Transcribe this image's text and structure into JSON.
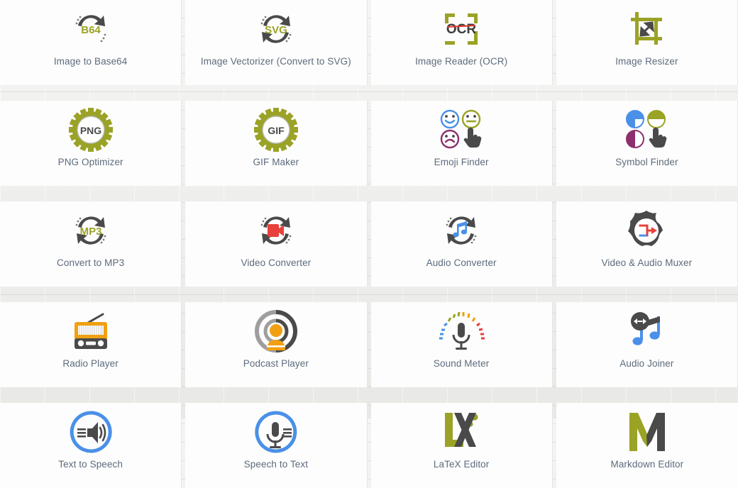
{
  "colors": {
    "olive": "#9aa326",
    "dark_gray": "#4a4a4a",
    "blue": "#4a90e8",
    "purple": "#8e2f6e",
    "red": "#e8403a",
    "orange": "#f0a011",
    "label": "#5d6b7c",
    "card_bg": "#fdfdfd",
    "page_bg": "#e9e9e7"
  },
  "grid": {
    "columns": 4,
    "rows": 5,
    "tools": [
      {
        "id": "image-to-base64",
        "label": "Image to Base64",
        "icon": "refresh-arrows-b64-icon"
      },
      {
        "id": "image-vectorizer",
        "label": "Image Vectorizer (Convert to SVG)",
        "icon": "refresh-arrows-svg-icon"
      },
      {
        "id": "image-reader-ocr",
        "label": "Image Reader (OCR)",
        "icon": "ocr-scan-frame-icon"
      },
      {
        "id": "image-resizer",
        "label": "Image Resizer",
        "icon": "crop-resize-arrow-icon"
      },
      {
        "id": "png-optimizer",
        "label": "PNG Optimizer",
        "icon": "gear-png-icon"
      },
      {
        "id": "gif-maker",
        "label": "GIF Maker",
        "icon": "gear-gif-icon"
      },
      {
        "id": "emoji-finder",
        "label": "Emoji Finder",
        "icon": "emoji-faces-pointer-icon"
      },
      {
        "id": "symbol-finder",
        "label": "Symbol Finder",
        "icon": "symbol-circles-pointer-icon"
      },
      {
        "id": "convert-to-mp3",
        "label": "Convert to MP3",
        "icon": "refresh-arrows-mp3-icon"
      },
      {
        "id": "video-converter",
        "label": "Video Converter",
        "icon": "refresh-arrows-camera-icon"
      },
      {
        "id": "audio-converter",
        "label": "Audio Converter",
        "icon": "refresh-arrows-music-note-icon"
      },
      {
        "id": "video-audio-muxer",
        "label": "Video & Audio Muxer",
        "icon": "gear-merge-arrows-icon"
      },
      {
        "id": "radio-player",
        "label": "Radio Player",
        "icon": "radio-icon"
      },
      {
        "id": "podcast-player",
        "label": "Podcast Player",
        "icon": "podcast-person-waves-icon"
      },
      {
        "id": "sound-meter",
        "label": "Sound Meter",
        "icon": "microphone-meter-icon"
      },
      {
        "id": "audio-joiner",
        "label": "Audio Joiner",
        "icon": "music-notes-merge-icon"
      },
      {
        "id": "text-to-speech",
        "label": "Text to Speech",
        "icon": "speaker-circle-icon"
      },
      {
        "id": "speech-to-text",
        "label": "Speech to Text",
        "icon": "microphone-circle-icon"
      },
      {
        "id": "latex-editor",
        "label": "LaTeX Editor",
        "icon": "latex-lx-icon"
      },
      {
        "id": "markdown-editor",
        "label": "Markdown Editor",
        "icon": "markdown-m-icon"
      }
    ]
  },
  "icon_text": {
    "b64": "B64",
    "svg": "SVG",
    "ocr": "OCR",
    "png": "PNG",
    "gif": "GIF",
    "mp3": "MP3"
  }
}
